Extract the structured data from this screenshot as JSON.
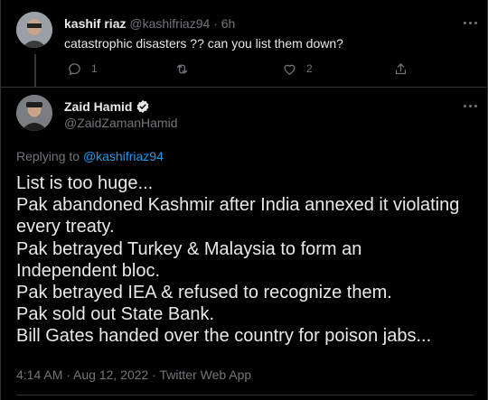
{
  "reply_tweet": {
    "author_name": "kashif riaz",
    "handle": "@kashifriaz94",
    "separator": "·",
    "time": "6h",
    "text": "catastrophic disasters ?? can you list them down?",
    "actions": {
      "reply_count": "1",
      "retweet_count": "",
      "like_count": "2"
    }
  },
  "main_tweet": {
    "author_name": "Zaid Hamid",
    "handle": "@ZaidZamanHamid",
    "replying_prefix": "Replying to",
    "replying_to": "@kashifriaz94",
    "lines": [
      "List is too huge...",
      "Pak abandoned Kashmir after India annexed it violating",
      "every treaty.",
      "Pak betrayed Turkey & Malaysia to form an",
      "Independent bloc.",
      "Pak betrayed IEA & refused to recognize them.",
      "Pak sold out State Bank.",
      "Bill Gates handed over the country for poison jabs..."
    ],
    "meta": "4:14 AM · Aug 12, 2022 · Twitter Web App"
  },
  "colors": {
    "background": "#000000",
    "text": "#e7e9ea",
    "secondary": "#71767b",
    "link": "#1d9bf0",
    "divider": "#2f3336"
  }
}
